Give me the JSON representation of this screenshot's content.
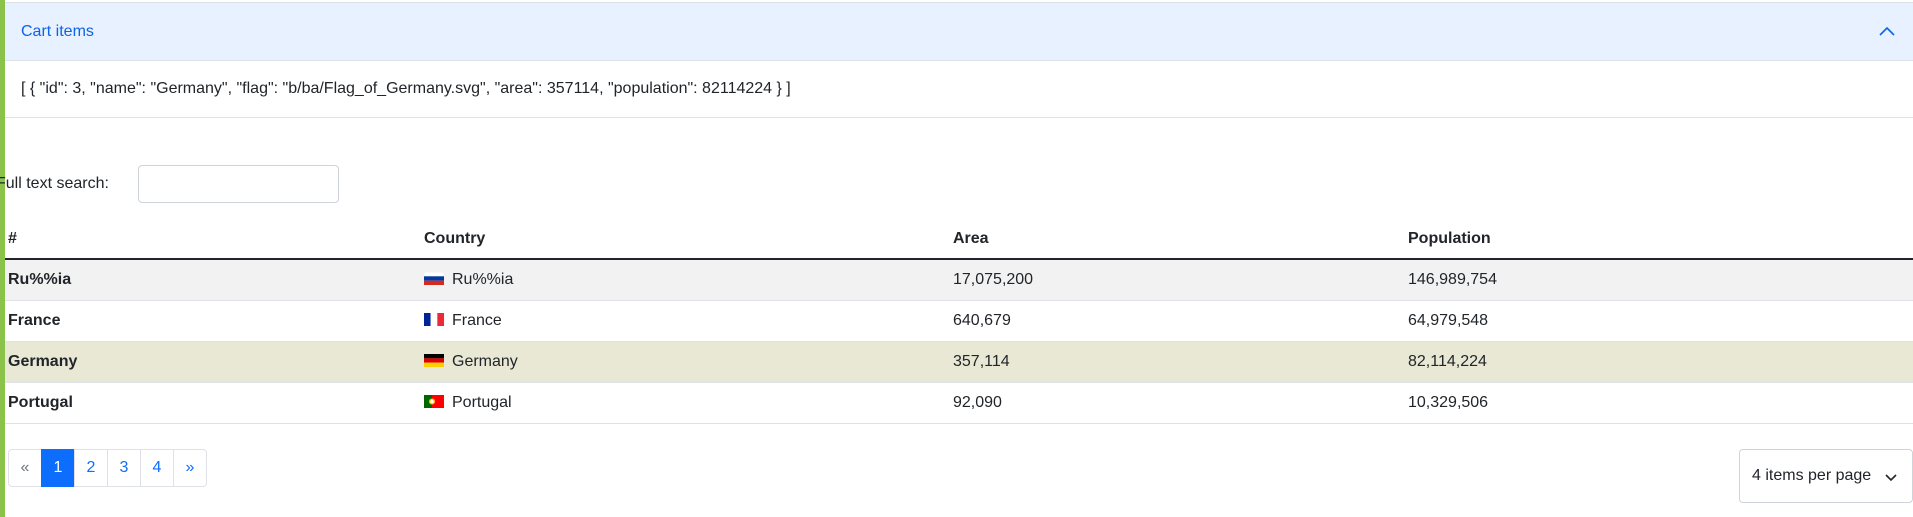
{
  "accordion": {
    "title": "Cart items",
    "body": "[ { \"id\": 3, \"name\": \"Germany\", \"flag\": \"b/ba/Flag_of_Germany.svg\", \"area\": 357114, \"population\": 82114224 } ]"
  },
  "search": {
    "label": "Full text search:",
    "value": ""
  },
  "table": {
    "headers": [
      "#",
      "Country",
      "Area",
      "Population"
    ],
    "rows": [
      {
        "id": "Ru%%ia",
        "country": "Ru%%ia",
        "flag_icon": "russia-flag-icon",
        "area": "17,075,200",
        "population": "146,989,754"
      },
      {
        "id": "France",
        "country": "France",
        "flag_icon": "france-flag-icon",
        "area": "640,679",
        "population": "64,979,548"
      },
      {
        "id": "Germany",
        "country": "Germany",
        "flag_icon": "germany-flag-icon",
        "area": "357,114",
        "population": "82,114,224"
      },
      {
        "id": "Portugal",
        "country": "Portugal",
        "flag_icon": "portugal-flag-icon",
        "area": "92,090",
        "population": "10,329,506"
      }
    ]
  },
  "pagination": {
    "prev": "«",
    "pages": [
      "1",
      "2",
      "3",
      "4"
    ],
    "current": "1",
    "next": "»"
  },
  "per_page": {
    "selected": "4 items per page"
  },
  "colors": {
    "accent": "#0d6efd",
    "accordion_bg": "#e7f1ff",
    "left_bar": "#8bc34a",
    "selected_row": "#e8e8d5",
    "striped_row": "#f2f2f2"
  }
}
